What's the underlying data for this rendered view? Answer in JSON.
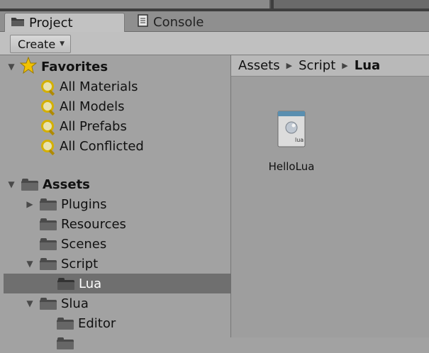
{
  "tabs": [
    {
      "label": "Project",
      "icon": "folder-icon",
      "active": true
    },
    {
      "label": "Console",
      "icon": "console-icon",
      "active": false
    }
  ],
  "toolbar": {
    "create_label": "Create"
  },
  "favorites": {
    "label": "Favorites",
    "items": [
      "All Materials",
      "All Models",
      "All Prefabs",
      "All Conflicted"
    ]
  },
  "assets": {
    "label": "Assets",
    "items": [
      {
        "label": "Plugins",
        "expanded": false
      },
      {
        "label": "Resources"
      },
      {
        "label": "Scenes"
      },
      {
        "label": "Script",
        "expanded": true
      },
      {
        "label": "Lua",
        "selected": true
      },
      {
        "label": "Slua",
        "expanded": true
      },
      {
        "label": "Editor"
      }
    ]
  },
  "breadcrumb": [
    "Assets",
    "Script",
    "Lua"
  ],
  "files": [
    {
      "name": "HelloLua",
      "icon": "lua-file-icon",
      "badge": "lua"
    }
  ],
  "colors": {
    "selection": "#6f6f6f",
    "star": "#f2c200",
    "search": "#d4b000"
  }
}
